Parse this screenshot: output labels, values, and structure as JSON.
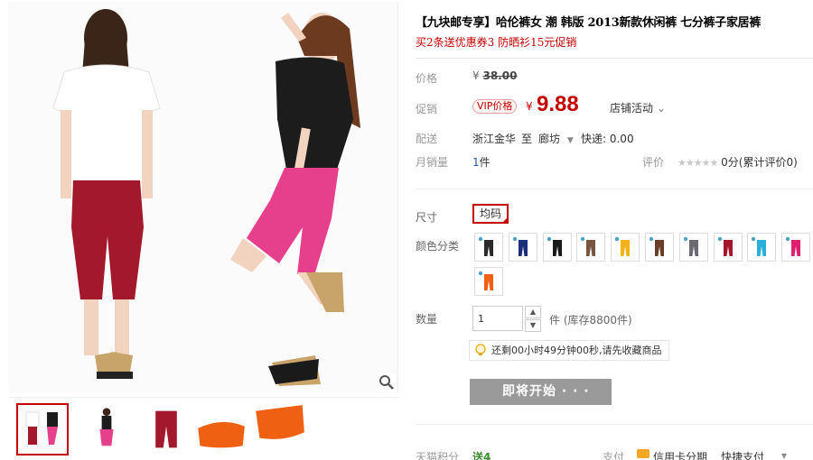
{
  "product": {
    "title": "【九块邮专享】哈伦裤女 潮 韩版 2013新款休闲裤 七分裤子家居裤",
    "promo_line": "买2条送优惠券3 防晒衫15元促销"
  },
  "price_section": {
    "orig_label": "价格",
    "orig_currency": "¥",
    "orig_price": "38.00",
    "promo_label": "促销",
    "vip_badge": "VIP价格",
    "currency": "¥",
    "price": "9.88",
    "shop_activity": "店铺活动",
    "chevron": "⌄"
  },
  "shipping": {
    "label": "配送",
    "from": "浙江金华",
    "to_word": "至",
    "to_city": "廊坊",
    "express": "快递: 0.00"
  },
  "sales": {
    "label": "月销量",
    "count": "1",
    "unit": "件",
    "review_label": "评价",
    "stars": "★★★★★",
    "rating_text": "0分(累计评价0)"
  },
  "size": {
    "label": "尺寸",
    "selected": "均码"
  },
  "colors": {
    "label": "颜色分类",
    "pants_colors": [
      "#2a2a2a",
      "#1c2f7a",
      "#1a1a1a",
      "#7a5540",
      "#f2b21a",
      "#6b3c2a",
      "#6a6a72",
      "#a3182a",
      "#2ab0d8",
      "#e0206e",
      "#f06012"
    ]
  },
  "quantity": {
    "label": "数量",
    "value": "1",
    "up": "▲",
    "down": "▼",
    "unit_stock": "件 (库存8800件)"
  },
  "tip": {
    "text": "还剩00小时49分钟00秒,请先收藏商品"
  },
  "buy_button": {
    "label": "即将开始 · · ·"
  },
  "bottom": {
    "points_label": "天猫积分",
    "points_value": "送4",
    "pay_label": "支付",
    "credit_label": "信用卡分期",
    "quick_pay": "快捷支付",
    "chevron": "▾"
  },
  "icons": {
    "zoom": "magnifier-icon",
    "bulb": "lightbulb-icon",
    "card": "credit-card-icon"
  },
  "colors_theme": {
    "accent_red": "#c40000",
    "disabled_button": "#9a9a9a"
  }
}
